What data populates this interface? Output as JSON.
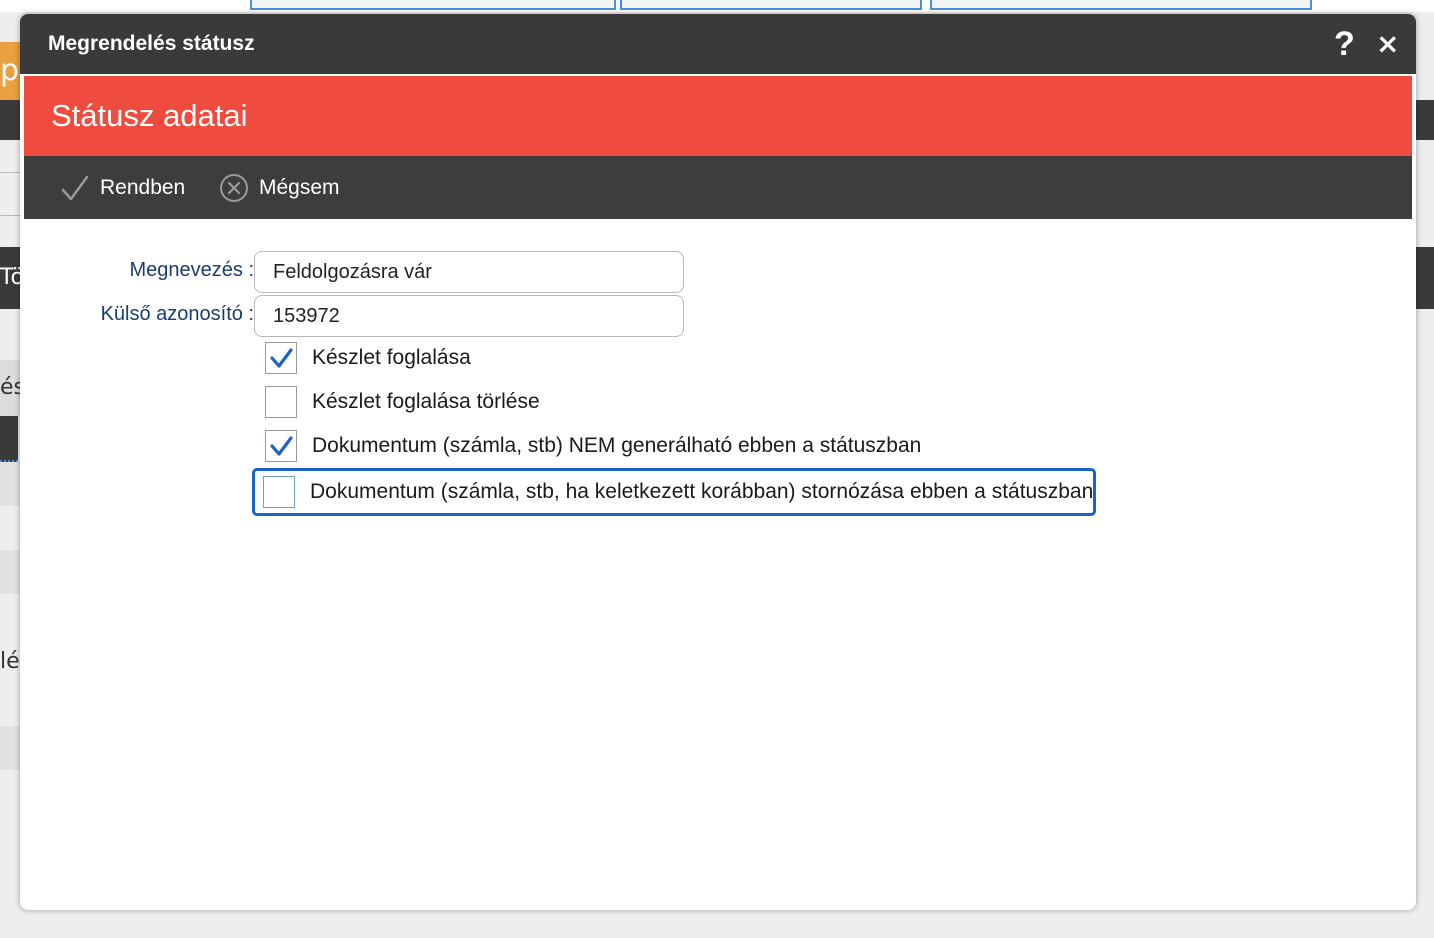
{
  "background": {
    "fragment_1": "pg",
    "fragment_2": "Tö",
    "fragment_3": "és",
    "fragment_4": "lé"
  },
  "dialog": {
    "window_title": "Megrendelés státusz",
    "help_icon": "?",
    "close_icon": "×",
    "section_title": "Státusz adatai",
    "toolbar": {
      "ok_label": "Rendben",
      "cancel_label": "Mégsem"
    },
    "form": {
      "name_label": "Megnevezés :",
      "name_value": "Feldolgozásra vár",
      "external_id_label": "Külső azonosító :",
      "external_id_value": "153972",
      "checkboxes": [
        {
          "label": "Készlet foglalása",
          "checked": true
        },
        {
          "label": "Készlet foglalása törlése",
          "checked": false
        },
        {
          "label": "Dokumentum (számla, stb) NEM generálható ebben a státuszban",
          "checked": true
        },
        {
          "label": "Dokumentum (számla, stb, ha keletkezett korábban) stornózása ebben a státuszban",
          "checked": false,
          "focused": true
        }
      ]
    },
    "colors": {
      "titlebar": "#3a3a3a",
      "header": "#ef4c3f",
      "toolbar": "#3d3d3d",
      "label": "#1a3d6e",
      "check": "#1a64c4",
      "focus": "#1a64c4"
    }
  }
}
